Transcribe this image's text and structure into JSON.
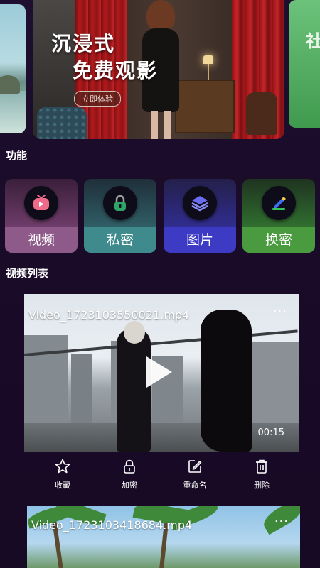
{
  "banner": {
    "headline_line1": "沉浸式",
    "headline_line2": "免费观影",
    "cta_label": "立即体验",
    "next_slide_glyph": "社"
  },
  "functions": {
    "title": "功能",
    "items": [
      {
        "label": "视频",
        "icon": "tv-icon",
        "color": "#8e5a8a"
      },
      {
        "label": "私密",
        "icon": "lock-icon",
        "color": "#3f8a8d"
      },
      {
        "label": "图片",
        "icon": "layers-icon",
        "color": "#3d3ac4"
      },
      {
        "label": "换密",
        "icon": "edit-icon",
        "color": "#4a9a3f"
      }
    ]
  },
  "video_list": {
    "title": "视频列表",
    "videos": [
      {
        "filename": "Video_1723103550021.mp4",
        "duration": "00:15",
        "more": "···"
      },
      {
        "filename": "Video_1723103418684.mp4",
        "more": "···"
      }
    ],
    "actions": [
      {
        "label": "收藏",
        "icon": "star-icon"
      },
      {
        "label": "加密",
        "icon": "lock-icon"
      },
      {
        "label": "重命名",
        "icon": "edit-icon"
      },
      {
        "label": "删除",
        "icon": "trash-icon"
      }
    ]
  }
}
